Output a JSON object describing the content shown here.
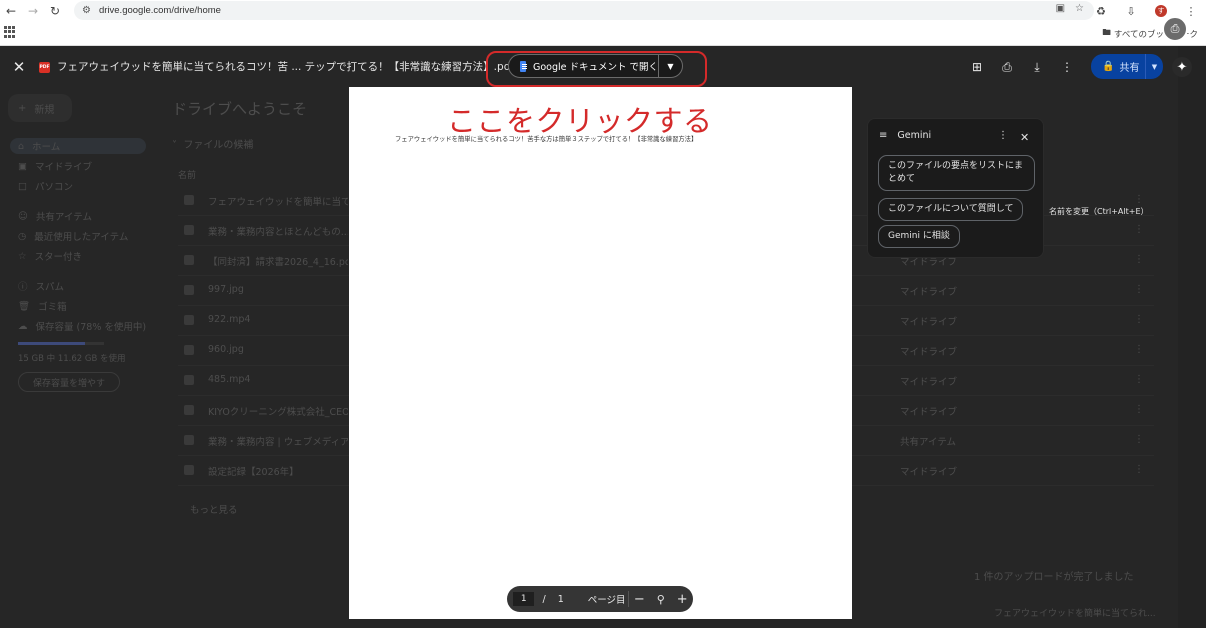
{
  "browser": {
    "url": "drive.google.com/drive/home",
    "avatar_initial": "す",
    "bookmarks_all_label": "すべてのブックマーク"
  },
  "drive": {
    "new_label": "新規",
    "sidebar": [
      {
        "label": "ホーム",
        "icon": "home-icon"
      },
      {
        "label": "マイドライブ",
        "icon": "drive-icon"
      },
      {
        "label": "パソコン",
        "icon": "computer-icon"
      },
      {
        "label": "共有アイテム",
        "icon": "people-icon"
      },
      {
        "label": "最近使用したアイテム",
        "icon": "clock-icon"
      },
      {
        "label": "スター付き",
        "icon": "star-icon"
      },
      {
        "label": "スパム",
        "icon": "spam-icon"
      },
      {
        "label": "ゴミ箱",
        "icon": "trash-icon"
      },
      {
        "label": "保存容量 (78% を使用中)",
        "icon": "cloud-icon"
      }
    ],
    "storage_text": "15 GB 中 11.62 GB を使用",
    "storage_button": "保存容量を増やす",
    "welcome": "ドライブへようこそ",
    "section_title": "ファイルの候補",
    "column_name": "名前",
    "files": [
      {
        "name": "フェアウェイウッドを簡単に当てら...",
        "location": "マイドライブ"
      },
      {
        "name": "業務・業務内容とほとんどもの...",
        "location": "マイドライブ"
      },
      {
        "name": "【同封済】請求書2026_4_16.pdf",
        "location": "マイドライブ"
      },
      {
        "name": "997.jpg",
        "location": "マイドライブ"
      },
      {
        "name": "922.mp4",
        "location": "マイドライブ"
      },
      {
        "name": "960.jpg",
        "location": "マイドライブ"
      },
      {
        "name": "485.mp4",
        "location": "マイドライブ"
      },
      {
        "name": "KIYOクリーニング株式会社_CEO_...",
        "location": "マイドライブ"
      },
      {
        "name": "業務・業務内容 | ウェブメディア...",
        "location": "共有アイテム"
      },
      {
        "name": "設定記録【2026年】",
        "location": "マイドライブ"
      }
    ],
    "more_link": "もっと見る",
    "toast_title": "1 件のアップロードが完了しました",
    "toast_file": "フェアウェイウッドを簡単に当てられ..."
  },
  "viewer": {
    "file_badge": "PDF",
    "title": "フェアウェイウッドを簡単に当てられるコツ！苦 ... テップで打てる！【非常識な練習方法】.pdf",
    "open_with_label": "Google ドキュメント で開く",
    "share_label": "共有"
  },
  "pdf": {
    "annotation": "ここをクリックする",
    "heading": "フェアウェイウッドを簡単に当てられるコツ！苦手な方は簡単３ステップで打てる！【非常識な練習方法】"
  },
  "gemini": {
    "title": "Gemini",
    "chips": [
      "このファイルの要点をリストにまとめて",
      "このファイルについて質問して",
      "Gemini に相談"
    ],
    "rename_tip": "名前を変更（Ctrl+Alt+E）"
  },
  "page_controls": {
    "current": "1",
    "separator": "/",
    "total": "1",
    "label": "ページ目"
  }
}
